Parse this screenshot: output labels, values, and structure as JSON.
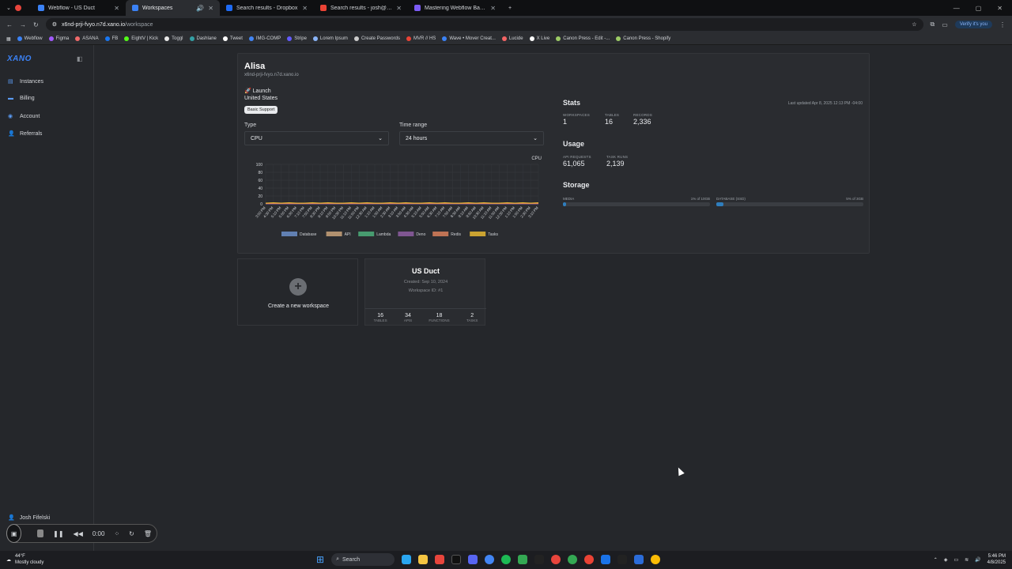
{
  "browser": {
    "tabs": [
      {
        "title": "Webflow - US Duct",
        "color": "#3b82f6"
      },
      {
        "title": "Workspaces",
        "color": "#3b82f6"
      },
      {
        "title": "Search results - Dropbox",
        "color": "#1e6bf5"
      },
      {
        "title": "Search results - josh@movercr",
        "color": "#ea4335"
      },
      {
        "title": "Mastering Webflow Basics",
        "color": "#7c5cf5"
      }
    ],
    "url_host": "x6nd-prji-fvyo.n7d.xano.io",
    "url_path": "/workspace",
    "verify_label": "Verify it's you",
    "bookmarks": [
      "Webflow",
      "Figma",
      "ASANA",
      "FB",
      "EightV | Kick",
      "Toggl",
      "Dashlane",
      "Tweet",
      "IMG-COMP",
      "Stripe",
      "Lorem Ipsum",
      "Create Passwords",
      "MVR // HS",
      "Wave • Mover Creat...",
      "Lucide",
      "X Live",
      "Canon Press - Edit -...",
      "Canon Press - Shopify"
    ]
  },
  "sidebar": {
    "logo": "XANO",
    "items": [
      {
        "label": "Instances",
        "icon": "instances-icon"
      },
      {
        "label": "Billing",
        "icon": "billing-icon"
      },
      {
        "label": "Account",
        "icon": "account-icon"
      },
      {
        "label": "Referrals",
        "icon": "referrals-icon"
      }
    ],
    "user": "Josh Fifelski"
  },
  "instance": {
    "name": "Alisa",
    "host": "x6nd-prji-fvyo.n7d.xano.io",
    "plan": "🚀 Launch",
    "region": "United States",
    "support_badge": "Basic Support",
    "type_label": "Type",
    "type_value": "CPU",
    "range_label": "Time range",
    "range_value": "24 hours",
    "stats_title": "Stats",
    "last_updated": "Last updated Apr 8, 2025 12:13 PM -04:00",
    "stats": [
      {
        "label": "WORKSPACES",
        "value": "1"
      },
      {
        "label": "TABLES",
        "value": "16"
      },
      {
        "label": "RECORDS",
        "value": "2,336"
      }
    ],
    "usage_title": "Usage",
    "usage": [
      {
        "label": "API REQUESTS",
        "value": "61,065"
      },
      {
        "label": "TASK RUNS",
        "value": "2,139"
      }
    ],
    "storage_title": "Storage",
    "storage": [
      {
        "label": "MEDIA",
        "detail": "1% of 10GB",
        "fraction": 0.01
      },
      {
        "label": "DATABASE (SSD)",
        "detail": "5% of 3GB",
        "fraction": 0.05
      }
    ]
  },
  "chart_data": {
    "type": "line",
    "title": "CPU",
    "ylim": [
      0,
      100
    ],
    "yticks": [
      "100",
      "80",
      "60",
      "40",
      "20",
      "0"
    ],
    "x": [
      "3:50 PM",
      "4:30 PM",
      "5:10 PM",
      "5:50 PM",
      "6:30 PM",
      "7:10 PM",
      "7:50 PM",
      "8:30 PM",
      "9:10 PM",
      "9:50 PM",
      "10:30 PM",
      "11:10 PM",
      "11:50 PM",
      "12:30 AM",
      "1:10 AM",
      "1:50 AM",
      "2:30 AM",
      "3:10 AM",
      "3:50 AM",
      "4:30 AM",
      "5:10 AM",
      "5:50 AM",
      "6:30 AM",
      "7:10 AM",
      "7:50 AM",
      "8:30 AM",
      "9:10 AM",
      "9:50 AM",
      "10:30 AM",
      "11:10 AM",
      "11:50 AM",
      "12:30 PM",
      "1:10 PM",
      "1:50 PM",
      "2:30 PM",
      "3:10 PM"
    ],
    "series": [
      {
        "name": "Database",
        "color": "#6b8fc9",
        "values": [
          1,
          1,
          1,
          1,
          1,
          1,
          1,
          1,
          1,
          1,
          1,
          1,
          1,
          1,
          1,
          1,
          1,
          1,
          1,
          1,
          1,
          1,
          1,
          1,
          1,
          1,
          1,
          1,
          1,
          1,
          1,
          1,
          1,
          1,
          1,
          1
        ]
      },
      {
        "name": "API",
        "color": "#c9a37a",
        "values": [
          1,
          1,
          1,
          1,
          1,
          1,
          1,
          1,
          1,
          1,
          1,
          1,
          1,
          1,
          1,
          1,
          1,
          1,
          1,
          1,
          1,
          1,
          1,
          1,
          1,
          1,
          1,
          1,
          1,
          1,
          1,
          1,
          1,
          1,
          1,
          1
        ]
      },
      {
        "name": "Lambda",
        "color": "#4caf7a",
        "values": [
          0,
          0,
          0,
          0,
          0,
          0,
          0,
          0,
          0,
          0,
          0,
          0,
          0,
          0,
          0,
          0,
          0,
          0,
          0,
          0,
          0,
          0,
          0,
          0,
          0,
          0,
          0,
          0,
          0,
          0,
          0,
          0,
          0,
          0,
          0,
          0
        ]
      },
      {
        "name": "Deno",
        "color": "#8e5ea2",
        "values": [
          0,
          0,
          0,
          0,
          0,
          0,
          0,
          0,
          0,
          0,
          0,
          0,
          0,
          0,
          0,
          0,
          0,
          0,
          0,
          0,
          0,
          0,
          0,
          0,
          0,
          0,
          0,
          0,
          0,
          0,
          0,
          0,
          0,
          0,
          0,
          0
        ]
      },
      {
        "name": "Redis",
        "color": "#d9805a",
        "values": [
          1,
          1,
          1,
          1,
          1,
          1,
          1,
          1,
          1,
          1,
          1,
          1,
          1,
          1,
          1,
          1,
          1,
          1,
          1,
          1,
          1,
          1,
          1,
          1,
          1,
          1,
          1,
          1,
          1,
          1,
          1,
          1,
          1,
          1,
          1,
          1
        ]
      },
      {
        "name": "Tasks",
        "color": "#e8b931",
        "values": [
          2,
          3,
          2,
          3,
          2,
          2,
          3,
          2,
          3,
          2,
          2,
          3,
          2,
          3,
          2,
          2,
          3,
          2,
          3,
          2,
          2,
          3,
          2,
          3,
          2,
          2,
          3,
          2,
          3,
          2,
          2,
          3,
          2,
          3,
          2,
          3
        ]
      }
    ]
  },
  "workspaces": {
    "create_label": "Create a new workspace",
    "cards": [
      {
        "name": "US Duct",
        "created": "Created: Sep 10, 2024",
        "workspace_id": "Workspace ID: #1",
        "stats": [
          {
            "value": "16",
            "label": "TABLES"
          },
          {
            "value": "34",
            "label": "APIS"
          },
          {
            "value": "18",
            "label": "FUNCTIONS"
          },
          {
            "value": "2",
            "label": "TASKS"
          }
        ]
      }
    ]
  },
  "recorder": {
    "time": "0:00"
  },
  "taskbar": {
    "temp": "44°F",
    "weather": "Mostly cloudy",
    "search_placeholder": "Search",
    "time": "5:46 PM",
    "date": "4/8/2025"
  }
}
